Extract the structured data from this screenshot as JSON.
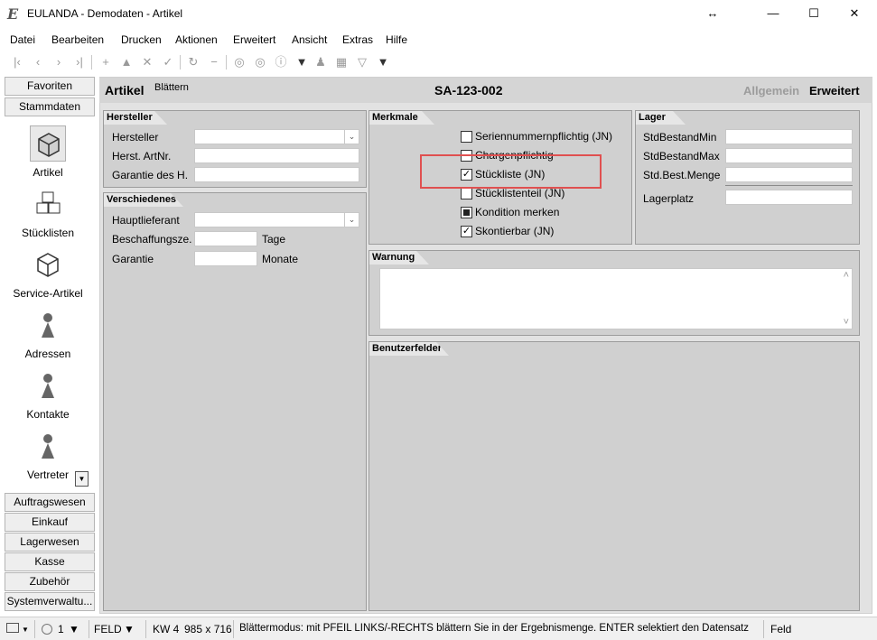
{
  "window": {
    "title": "EULANDA - Demodaten - Artikel",
    "icon_letter": "E",
    "resize_glyph": "↔",
    "minimize_glyph": "—",
    "maximize_glyph": "☐",
    "close_glyph": "✕"
  },
  "menu": [
    "Datei",
    "Bearbeiten",
    "Drucken",
    "Aktionen",
    "Erweitert",
    "Ansicht",
    "Extras",
    "Hilfe"
  ],
  "toolbar": {
    "icons": [
      "first-record-icon",
      "previous-record-icon",
      "next-record-icon",
      "last-record-icon",
      "add-icon",
      "up-icon",
      "cancel-icon",
      "confirm-icon",
      "refresh-icon",
      "delete-icon",
      "binoculars-icon",
      "target-icon",
      "info-icon",
      "dropdown-icon",
      "person-icon",
      "grid-icon",
      "filter-icon",
      "dropdown-icon"
    ],
    "glyphs": [
      "|‹",
      "‹",
      "›",
      "›|",
      "+",
      "▲",
      "✕",
      "✓",
      "↻",
      "−",
      "◎",
      "◎",
      "ⓘ",
      "▼",
      "♟",
      "▦",
      "▽",
      "▼"
    ]
  },
  "nav": {
    "favoriten": "Favoriten",
    "stammdaten": "Stammdaten",
    "tiles": [
      {
        "label": "Artikel",
        "icon": "cube-icon"
      },
      {
        "label": "Stücklisten",
        "icon": "cubes-icon"
      },
      {
        "label": "Service-Artikel",
        "icon": "cube-icon"
      },
      {
        "label": "Adressen",
        "icon": "person-icon"
      },
      {
        "label": "Kontakte",
        "icon": "person-icon"
      },
      {
        "label": "Vertreter",
        "icon": "person-icon"
      }
    ],
    "scroll_glyph": "▼",
    "bottom": [
      "Auftragswesen",
      "Einkauf",
      "Lagerwesen",
      "Kasse",
      "Zubehör",
      "Systemverwaltu..."
    ]
  },
  "context": {
    "title": "Artikel",
    "mode": "Blättern",
    "record_id": "SA-123-002",
    "tab_allgemein": "Allgemein",
    "tab_erweitert": "Erweitert"
  },
  "hersteller": {
    "heading": "Hersteller",
    "hersteller_label": "Hersteller",
    "artnr_label": "Herst. ArtNr.",
    "garantie_label": "Garantie des H.",
    "hersteller_value": "",
    "artnr_value": "",
    "garantie_value": ""
  },
  "verschiedenes": {
    "heading": "Verschiedenes",
    "hauptlieferant_label": "Hauptlieferant",
    "beschaffung_label": "Beschaffungsze.",
    "beschaffung_unit": "Tage",
    "garantie_label": "Garantie",
    "garantie_unit": "Monate",
    "hauptlieferant_value": "",
    "beschaffung_value": "",
    "garantie_value": ""
  },
  "merkmale": {
    "heading": "Merkmale",
    "items": [
      {
        "label": "Seriennummernpflichtig (JN)",
        "state": "unchecked"
      },
      {
        "label": "Chargenpflichtig",
        "state": "unchecked"
      },
      {
        "label": "Stückliste (JN)",
        "state": "checked"
      },
      {
        "label": "Stücklistenteil (JN)",
        "state": "unchecked"
      },
      {
        "label": "Kondition merken",
        "state": "indeterminate"
      },
      {
        "label": "Skontierbar (JN)",
        "state": "checked"
      }
    ],
    "check_glyph": "✓",
    "highlight_color": "#e05050"
  },
  "lager": {
    "heading": "Lager",
    "labels": [
      "StdBestandMin",
      "StdBestandMax",
      "Std.Best.Menge",
      "Lagerplatz"
    ],
    "values": [
      "",
      "",
      "",
      ""
    ]
  },
  "warnung": {
    "heading": "Warnung",
    "value": "",
    "scroll_up": "˄",
    "scroll_down": "˅"
  },
  "benutzerfelder": {
    "heading": "Benutzerfelder"
  },
  "status": {
    "page_number": "1",
    "dropdown_glyph": "▼",
    "mode": "FELD",
    "week": "KW 4",
    "size": "985 x 716",
    "message": "Blättermodus: mit PFEIL LINKS/-RECHTS blättern Sie in der Ergebnismenge. ENTER selektiert den Datensatz",
    "field": "Feld"
  }
}
